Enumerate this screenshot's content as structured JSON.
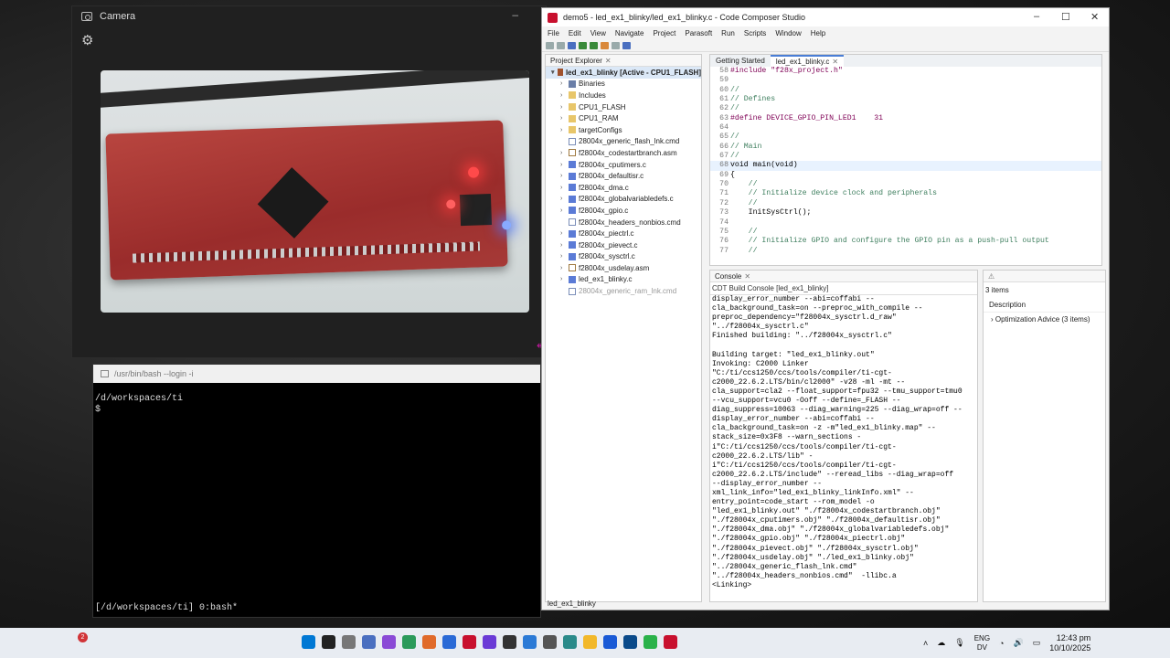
{
  "camera": {
    "title": "Camera",
    "icon": "camera-icon",
    "settings_icon": "gear-icon"
  },
  "terminal": {
    "title": "/usr/bin/bash --login -i",
    "lines": [
      "/d/workspaces/ti",
      "$ "
    ],
    "status": "[/d/workspaces/ti] 0:bash*"
  },
  "ccs": {
    "title": "demo5 - led_ex1_blinky/led_ex1_blinky.c - Code Composer Studio",
    "menu": [
      "File",
      "Edit",
      "View",
      "Navigate",
      "Project",
      "Parasoft",
      "Run",
      "Scripts",
      "Window",
      "Help"
    ],
    "project_explorer": {
      "tab_label": "Project Explorer",
      "root": "led_ex1_blinky  [Active - CPU1_FLASH]",
      "items": [
        {
          "label": "Binaries",
          "type": "bin"
        },
        {
          "label": "Includes",
          "type": "folder"
        },
        {
          "label": "CPU1_FLASH",
          "type": "folder"
        },
        {
          "label": "CPU1_RAM",
          "type": "folder"
        },
        {
          "label": "targetConfigs",
          "type": "folder"
        },
        {
          "label": "28004x_generic_flash_lnk.cmd",
          "type": "file"
        },
        {
          "label": "f28004x_codestartbranch.asm",
          "type": "asm"
        },
        {
          "label": "f28004x_cputimers.c",
          "type": "c"
        },
        {
          "label": "f28004x_defaultisr.c",
          "type": "c"
        },
        {
          "label": "f28004x_dma.c",
          "type": "c"
        },
        {
          "label": "f28004x_globalvariabledefs.c",
          "type": "c"
        },
        {
          "label": "f28004x_gpio.c",
          "type": "c"
        },
        {
          "label": "f28004x_headers_nonbios.cmd",
          "type": "file"
        },
        {
          "label": "f28004x_piectrl.c",
          "type": "c"
        },
        {
          "label": "f28004x_pievect.c",
          "type": "c"
        },
        {
          "label": "f28004x_sysctrl.c",
          "type": "c"
        },
        {
          "label": "f28004x_usdelay.asm",
          "type": "asm"
        },
        {
          "label": "led_ex1_blinky.c",
          "type": "c"
        },
        {
          "label": "28004x_generic_ram_lnk.cmd",
          "type": "muted"
        }
      ]
    },
    "editor": {
      "tabs": [
        "Getting Started",
        "led_ex1_blinky.c"
      ],
      "lines": [
        {
          "n": "58",
          "t": "#include \"f28x_project.h\""
        },
        {
          "n": "59",
          "t": ""
        },
        {
          "n": "60",
          "t": "//"
        },
        {
          "n": "61",
          "t": "// Defines"
        },
        {
          "n": "62",
          "t": "//"
        },
        {
          "n": "63",
          "t": "#define DEVICE_GPIO_PIN_LED1    31"
        },
        {
          "n": "64",
          "t": ""
        },
        {
          "n": "65",
          "t": "//"
        },
        {
          "n": "66",
          "t": "// Main"
        },
        {
          "n": "67",
          "t": "//"
        },
        {
          "n": "68",
          "t": "void main(void)"
        },
        {
          "n": "69",
          "t": "{"
        },
        {
          "n": "70",
          "t": "    //"
        },
        {
          "n": "71",
          "t": "    // Initialize device clock and peripherals"
        },
        {
          "n": "72",
          "t": "    //"
        },
        {
          "n": "73",
          "t": "    InitSysCtrl();"
        },
        {
          "n": "74",
          "t": ""
        },
        {
          "n": "75",
          "t": "    //"
        },
        {
          "n": "76",
          "t": "    // Initialize GPIO and configure the GPIO pin as a push-pull output"
        },
        {
          "n": "77",
          "t": "    //"
        }
      ]
    },
    "console": {
      "tab_label": "Console",
      "subtitle": "CDT Build Console [led_ex1_blinky]",
      "text": "display_error_number --abi=coffabi --\ncla_background_task=on --preproc_with_compile --\npreproc_dependency=\"f28004x_sysctrl.d_raw\"\n\"../f28004x_sysctrl.c\"\nFinished building: \"../f28004x_sysctrl.c\"\n\nBuilding target: \"led_ex1_blinky.out\"\nInvoking: C2000 Linker\n\"C:/ti/ccs1250/ccs/tools/compiler/ti-cgt-\nc2000_22.6.2.LTS/bin/cl2000\" -v28 -ml -mt --\ncla_support=cla2 --float_support=fpu32 --tmu_support=tmu0\n--vcu_support=vcu0 -Ooff --define=_FLASH --\ndiag_suppress=10063 --diag_warning=225 --diag_wrap=off --\ndisplay_error_number --abi=coffabi --\ncla_background_task=on -z -m\"led_ex1_blinky.map\" --\nstack_size=0x3F8 --warn_sections -\ni\"C:/ti/ccs1250/ccs/tools/compiler/ti-cgt-\nc2000_22.6.2.LTS/lib\" -\ni\"C:/ti/ccs1250/ccs/tools/compiler/ti-cgt-\nc2000_22.6.2.LTS/include\" --reread_libs --diag_wrap=off\n--display_error_number --\nxml_link_info=\"led_ex1_blinky_linkInfo.xml\" --\nentry_point=code_start --rom_model -o\n\"led_ex1_blinky.out\" \"./f28004x_codestartbranch.obj\"\n\"./f28004x_cputimers.obj\" \"./f28004x_defaultisr.obj\"\n\"./f28004x_dma.obj\" \"./f28004x_globalvariabledefs.obj\"\n\"./f28004x_gpio.obj\" \"./f28004x_piectrl.obj\"\n\"./f28004x_pievect.obj\" \"./f28004x_sysctrl.obj\"\n\"./f28004x_usdelay.obj\" \"./led_ex1_blinky.obj\"\n\"../28004x_generic_flash_lnk.cmd\"\n\"../f28004x_headers_nonbios.cmd\"  -llibc.a\n<Linking>"
    },
    "problems": {
      "count": "3 items",
      "description_header": "Description",
      "entry": "Optimization Advice (3 items)"
    },
    "status": "led_ex1_blinky"
  },
  "taskbar": {
    "notification_count": "2",
    "language_top": "ENG",
    "language_bottom": "DV",
    "time": "12:43 pm",
    "date": "10/10/2025",
    "app_colors": [
      "#0078d4",
      "#222",
      "#777",
      "#4a6fc0",
      "#8a4ad6",
      "#2b9a5a",
      "#e06a2a",
      "#2a6ad6",
      "#c8102e",
      "#6a3ad6",
      "#333",
      "#2b7ad6",
      "#555",
      "#2a8a8a",
      "#f2b82a",
      "#1a5ad6",
      "#0a4a8a",
      "#2ab24a",
      "#c8102e"
    ]
  }
}
